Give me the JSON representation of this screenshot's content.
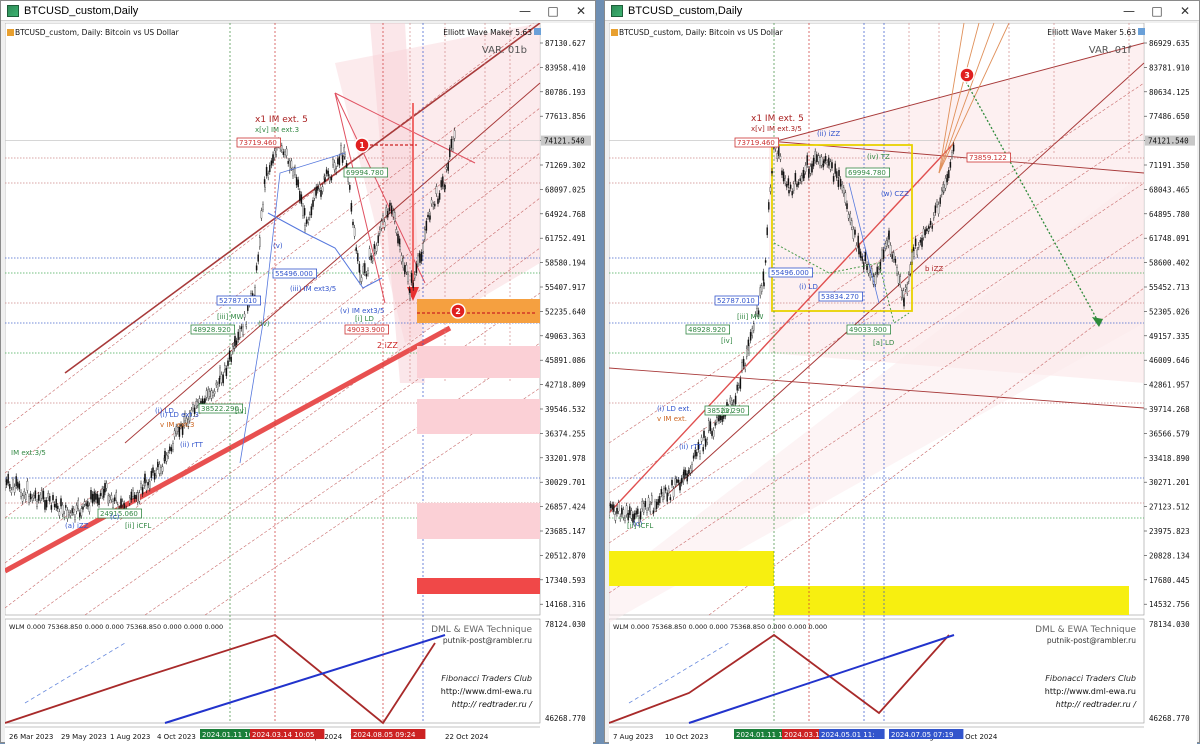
{
  "windows": [
    {
      "id": "left",
      "title": "BTCUSD_custom,Daily",
      "chart_header": "BTCUSD_custom, Daily:  Bitcoin vs US Dollar",
      "indicator_name": "Elliott Wave Maker 5.63",
      "variant": "VAR. 01b",
      "price_ticks": [
        "87130.627",
        "83958.410",
        "80786.193",
        "77613.856",
        "74121.540",
        "71269.302",
        "68097.025",
        "64924.768",
        "61752.491",
        "58580.194",
        "55407.917",
        "52235.640",
        "49063.363",
        "45891.086",
        "42718.809",
        "39546.532",
        "36374.255",
        "33201.978",
        "30029.701",
        "26857.424",
        "23685.147",
        "20512.870",
        "17340.593",
        "14168.316"
      ],
      "current_price": "74121.540",
      "indicator_ticks": [
        "78124.030",
        "46268.770"
      ],
      "indicator_header": "WLM 0.000 75368.850 0.000 0.000 75368.850 0.000 0.000 0.000",
      "brand_line1": "DML & EWA Technique",
      "brand_line2": "putnik-post@rambler.ru",
      "fib_club": "Fibonacci   Traders   Club",
      "url1": "http://www.dml-ewa.ru",
      "url2": "http:// redtrader.ru /",
      "date_labels": [
        "26 Mar 2023",
        "29 May 2023",
        "1 Aug 2023",
        "4 Oct 2023",
        "Apr 2024",
        "16",
        "2024",
        "22 Oct 2024"
      ],
      "date_boxes": [
        {
          "text": "2024.01.11 16",
          "color": "#1b7f3a"
        },
        {
          "text": "2024.03.14 10:05",
          "color": "#cc2222"
        },
        {
          "text": "2024.08.05 09:24",
          "color": "#cc2222"
        }
      ],
      "price_boxes": [
        {
          "text": "73719.460",
          "color": "#cc3333"
        },
        {
          "text": "69994.780",
          "color": "#338844"
        },
        {
          "text": "55496.000",
          "color": "#3355cc"
        },
        {
          "text": "52787.010",
          "color": "#3355cc"
        },
        {
          "text": "48928.920",
          "color": "#338844"
        },
        {
          "text": "49033.900",
          "color": "#cc3333"
        },
        {
          "text": "38522.290",
          "color": "#338844"
        },
        {
          "text": "24915.060",
          "color": "#338844"
        }
      ],
      "wave_labels": [
        "x1 IM ext. 5",
        "x[v] IM ext.3",
        "(iii) IM ext3/5",
        "(v) IM ext3/5",
        "2 iZZ",
        "[iii] MW",
        "(i) LD ext.3",
        "v IM ext.3",
        "(ii) rTT",
        "IM ext.3/5",
        "(a) iZZ",
        "(c)",
        "[ii] iCFL",
        "[i] LD",
        "[iv]",
        "(iv)",
        "(v)",
        "(i) LD"
      ],
      "markers": [
        "1",
        "2"
      ]
    },
    {
      "id": "right",
      "title": "BTCUSD_custom,Daily",
      "chart_header": "BTCUSD_custom, Daily:  Bitcoin vs US Dollar",
      "indicator_name": "Elliott Wave Maker 5.63",
      "variant": "VAR. 01f",
      "price_ticks": [
        "86929.635",
        "83781.910",
        "80634.125",
        "77486.650",
        "74121.540",
        "71191.350",
        "68043.465",
        "64895.780",
        "61748.091",
        "58600.402",
        "55452.713",
        "52305.026",
        "49157.335",
        "46009.646",
        "42861.957",
        "39714.268",
        "36566.579",
        "33418.890",
        "30271.201",
        "27123.512",
        "23975.823",
        "20828.134",
        "17680.445",
        "14532.756"
      ],
      "current_price": "74121.540",
      "indicator_ticks": [
        "78134.030",
        "46268.770"
      ],
      "indicator_header": "WLM 0.000 75368.850 0.000 0.000 75368.850 0.000 0.000 0.000",
      "brand_line1": "DML & EWA Technique",
      "brand_line2": "putnik-post@rambler.ru",
      "fib_club": "Fibonacci   Traders   Club",
      "url1": "http://www.dml-ewa.ru",
      "url2": "http:// redtrader.ru /",
      "date_labels": [
        "7 Aug 2023",
        "10 Oct 2023",
        "25 Aug 2024",
        "28 Oct 2024"
      ],
      "date_boxes": [
        {
          "text": "2024.01.11 16",
          "color": "#1b7f3a"
        },
        {
          "text": "2024.03.14",
          "color": "#cc2222"
        },
        {
          "text": "2024.05.01 11:",
          "color": "#3355cc"
        },
        {
          "text": "2024.07.05 07:19",
          "color": "#3355cc"
        }
      ],
      "price_boxes": [
        {
          "text": "73719.460",
          "color": "#cc3333"
        },
        {
          "text": "73859.122",
          "color": "#cc3333"
        },
        {
          "text": "69994.780",
          "color": "#338844"
        },
        {
          "text": "55496.000",
          "color": "#3355cc"
        },
        {
          "text": "53834.270",
          "color": "#3355cc"
        },
        {
          "text": "52787.010",
          "color": "#3355cc"
        },
        {
          "text": "48928.920",
          "color": "#338844"
        },
        {
          "text": "49033.900",
          "color": "#338844"
        },
        {
          "text": "38522.290",
          "color": "#338844"
        }
      ],
      "wave_labels": [
        "x1 IM ext. 5",
        "x[v] IM ext.3/5",
        "(ii) iZZ",
        "(iv) TZ",
        "(w) CZZ",
        "b iZZ",
        "[a] LD",
        "(i) LD ext.",
        "v IM ext.",
        "(ii) rTT",
        "[iii] MW",
        "[iv]",
        "(iv)",
        "(i) LD",
        "(c)",
        "[ii] iCFL"
      ],
      "markers": [
        "3"
      ]
    }
  ],
  "icons": [
    "minimize-icon",
    "maximize-icon",
    "close-icon",
    "app-icon"
  ]
}
